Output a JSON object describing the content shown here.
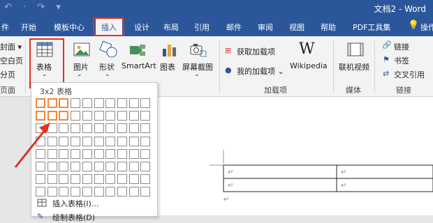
{
  "titlebar": {
    "quick_access": "↶ · ↷ ▾",
    "doc_title": "文档2 - Word"
  },
  "tabs": [
    {
      "id": "file",
      "label": "件"
    },
    {
      "id": "home",
      "label": "开始"
    },
    {
      "id": "template",
      "label": "模板中心"
    },
    {
      "id": "insert",
      "label": "插入",
      "active": true
    },
    {
      "id": "design",
      "label": "设计"
    },
    {
      "id": "layout",
      "label": "布局"
    },
    {
      "id": "references",
      "label": "引用"
    },
    {
      "id": "mailings",
      "label": "邮件"
    },
    {
      "id": "review",
      "label": "审阅"
    },
    {
      "id": "view",
      "label": "视图"
    },
    {
      "id": "help",
      "label": "帮助"
    },
    {
      "id": "pdf",
      "label": "PDF工具集"
    },
    {
      "id": "tellme",
      "label": "操作"
    }
  ],
  "ribbon": {
    "pages_group": {
      "cover": "封面",
      "blank": "空白页",
      "break": "分页",
      "label": "页面"
    },
    "table_button": "表格",
    "picture": "图片",
    "shapes": "形状",
    "smartart": "SmartArt",
    "chart": "图表",
    "screenshot": "屏幕截图",
    "get_addins": "获取加载项",
    "my_addins": "我的加载项",
    "wikipedia": "Wikipedia",
    "addins_label": "加载项",
    "online_video": "联机视频",
    "media_label": "媒体",
    "link": "链接",
    "bookmark": "书签",
    "cross_ref": "交叉引用",
    "links_label": "链接"
  },
  "dropdown": {
    "title": "3x2 表格",
    "insert_table": "插入表格(I)...",
    "draw_table": "绘制表格(D)"
  },
  "colors": {
    "brand": "#2b579a",
    "highlight": "#e0301e",
    "grid_select": "#f0883a"
  }
}
